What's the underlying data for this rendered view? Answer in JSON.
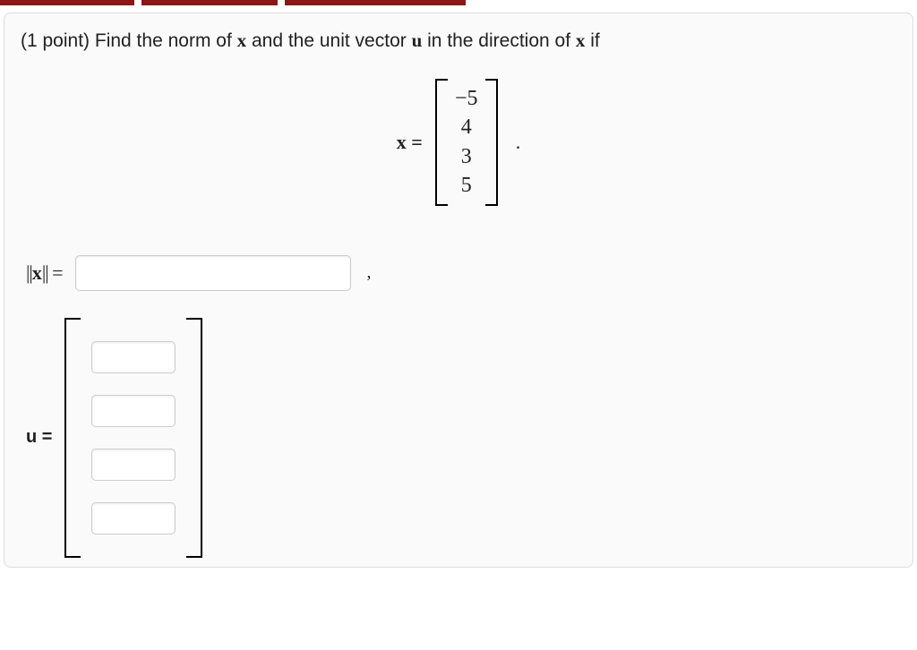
{
  "problem": {
    "points_prefix": "(1 point) ",
    "text_1": "Find the norm of ",
    "x_sym": "x",
    "text_2": " and the unit vector ",
    "u_sym": "u",
    "text_3": " in the direction of ",
    "text_4": " if"
  },
  "vector_label": "x =",
  "vector_x": [
    "−5",
    "4",
    "3",
    "5"
  ],
  "norm_label_pre": "||",
  "norm_label_sym": "x",
  "norm_label_post": "|| =",
  "norm_value": "",
  "comma": ",",
  "u_label": "u =",
  "u_values": [
    "",
    "",
    "",
    ""
  ]
}
